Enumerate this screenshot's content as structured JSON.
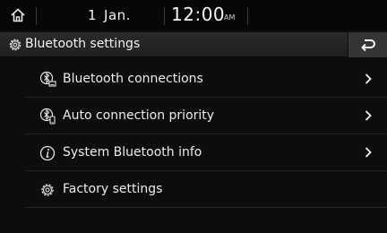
{
  "status": {
    "day": "1",
    "month": "Jan.",
    "time": "12:00",
    "ampm": "AM"
  },
  "header": {
    "title": "Bluetooth settings",
    "title_icon": "gear-icon",
    "back_icon": "back-arrow-icon"
  },
  "menu": {
    "items": [
      {
        "label": "Bluetooth connections",
        "icon": "bluetooth-device-icon",
        "has_chevron": true
      },
      {
        "label": "Auto connection priority",
        "icon": "bluetooth-phone-icon",
        "has_chevron": true
      },
      {
        "label": "System Bluetooth info",
        "icon": "info-icon",
        "has_chevron": true
      },
      {
        "label": "Factory settings",
        "icon": "gear-icon",
        "has_chevron": false
      }
    ]
  },
  "colors": {
    "background": "#0d0d0d",
    "titlebar": "#252525",
    "text": "#ececec"
  }
}
